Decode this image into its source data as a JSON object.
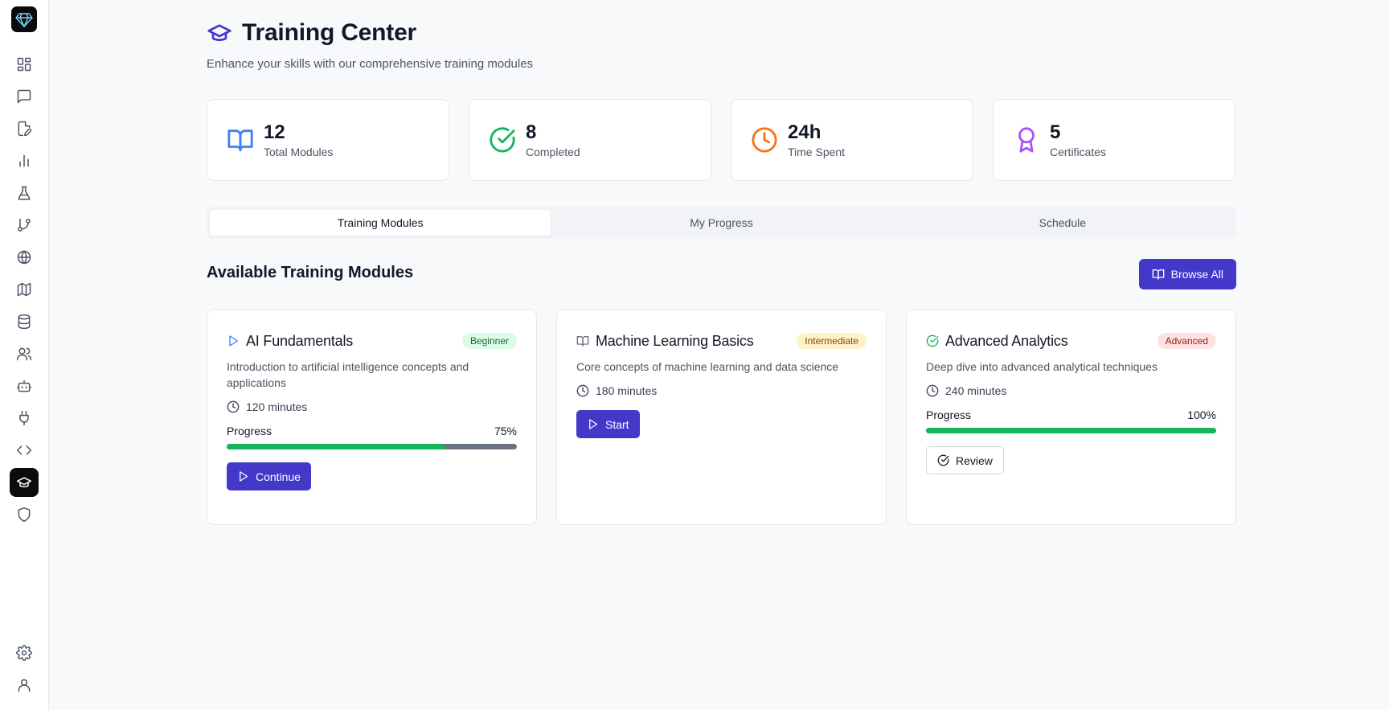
{
  "page": {
    "title": "Training Center",
    "subtitle": "Enhance your skills with our comprehensive training modules"
  },
  "sidebar": {
    "items": [
      {
        "name": "dashboard-icon"
      },
      {
        "name": "chat-icon"
      },
      {
        "name": "file-edit-icon"
      },
      {
        "name": "bar-chart-icon"
      },
      {
        "name": "flask-icon"
      },
      {
        "name": "git-branch-icon"
      },
      {
        "name": "globe-icon"
      },
      {
        "name": "map-icon"
      },
      {
        "name": "database-icon"
      },
      {
        "name": "users-icon"
      },
      {
        "name": "bot-icon"
      },
      {
        "name": "plug-icon"
      },
      {
        "name": "code-icon"
      },
      {
        "name": "graduation-cap-icon",
        "active": true
      },
      {
        "name": "shield-icon"
      }
    ],
    "bottom": [
      {
        "name": "settings-icon"
      },
      {
        "name": "user-icon"
      }
    ]
  },
  "stats": [
    {
      "value": "12",
      "label": "Total Modules",
      "icon": "book-open-icon",
      "color": "#3b82f6"
    },
    {
      "value": "8",
      "label": "Completed",
      "icon": "check-circle-icon",
      "color": "#16b55b"
    },
    {
      "value": "24h",
      "label": "Time Spent",
      "icon": "clock-icon",
      "color": "#f97316"
    },
    {
      "value": "5",
      "label": "Certificates",
      "icon": "award-icon",
      "color": "#a855f7"
    }
  ],
  "tabs": [
    {
      "label": "Training Modules",
      "active": true
    },
    {
      "label": "My Progress",
      "active": false
    },
    {
      "label": "Schedule",
      "active": false
    }
  ],
  "section": {
    "title": "Available Training Modules",
    "browse_label": "Browse All"
  },
  "modules": [
    {
      "title": "AI Fundamentals",
      "badge": "Beginner",
      "description": "Introduction to artificial intelligence concepts and applications",
      "duration": "120 minutes",
      "progress_label": "Progress",
      "progress_text": "75%",
      "progress": 0.75,
      "action": "Continue",
      "icon": "play-icon"
    },
    {
      "title": "Machine Learning Basics",
      "badge": "Intermediate",
      "description": "Core concepts of machine learning and data science",
      "duration": "180 minutes",
      "action": "Start",
      "icon": "book-icon"
    },
    {
      "title": "Advanced Analytics",
      "badge": "Advanced",
      "description": "Deep dive into advanced analytical techniques",
      "duration": "240 minutes",
      "progress_label": "Progress",
      "progress_text": "100%",
      "progress": 1.0,
      "action": "Review",
      "icon": "check-circle-icon"
    }
  ],
  "colors": {
    "accent": "#4338ca",
    "progress": "#16b55b"
  }
}
